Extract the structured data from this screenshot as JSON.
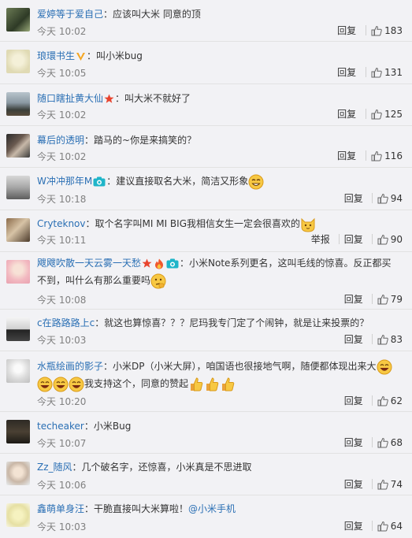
{
  "comments": [
    {
      "name": "爱婷等于爱自己",
      "text": "应该叫大米 同意的顶",
      "time": "今天 10:02",
      "reply": "回复",
      "likes": "183"
    },
    {
      "name": "琅環书生",
      "text": "叫小米bug",
      "time": "今天 10:05",
      "reply": "回复",
      "likes": "131"
    },
    {
      "name": "随口瞎扯黄大仙",
      "text": "叫大米不就好了",
      "time": "今天 10:02",
      "reply": "回复",
      "likes": "125"
    },
    {
      "name": "幕后的透明",
      "text": "踏马的~你是来搞笑的？",
      "time": "今天 10:02",
      "reply": "回复",
      "likes": "116"
    },
    {
      "name": "W冲冲那年M",
      "text": "建议直接取名大米，简洁又形象",
      "time": "今天 10:18",
      "reply": "回复",
      "likes": "94"
    },
    {
      "name": "Cryteknov",
      "text": "取个名字叫MI MI BIG我相信女生一定会很喜欢的",
      "time": "今天 10:11",
      "report": "举报",
      "reply": "回复",
      "likes": "90"
    },
    {
      "name": "飕飕吹散一天云雾一天愁",
      "text_a": "小米Note系列更名，这叫毛线的惊喜。反正都买",
      "text_b": "不到，叫什么有那么重要吗",
      "time": "今天 10:08",
      "reply": "回复",
      "likes": "79"
    },
    {
      "name": "c在路路路上c",
      "text": "就这也算惊喜？？？尼玛我专门定了个闹钟，就是让来投票的？",
      "time": "今天 10:03",
      "reply": "回复",
      "likes": "83"
    },
    {
      "name": "水瓶绘画的影子",
      "text_a": "小米DP（小米大屏），咱国语也很接地气啊，随便都体现出来大",
      "text_b": "我支持这个，同意的赞起",
      "time": "今天 10:20",
      "reply": "回复",
      "likes": "62"
    },
    {
      "name": "techeaker",
      "text": "小米Bug",
      "time": "今天 10:07",
      "reply": "回复",
      "likes": "68"
    },
    {
      "name": "Zz_随风",
      "text": "几个破名字，还惊喜，小米真是不思进取",
      "time": "今天 10:06",
      "reply": "回复",
      "likes": "74"
    },
    {
      "name": "鑫萌单身汪",
      "text": "干脆直接叫大米算啦！",
      "mention": "@小米手机",
      "time": "今天 10:03",
      "reply": "回复",
      "likes": "64"
    }
  ]
}
